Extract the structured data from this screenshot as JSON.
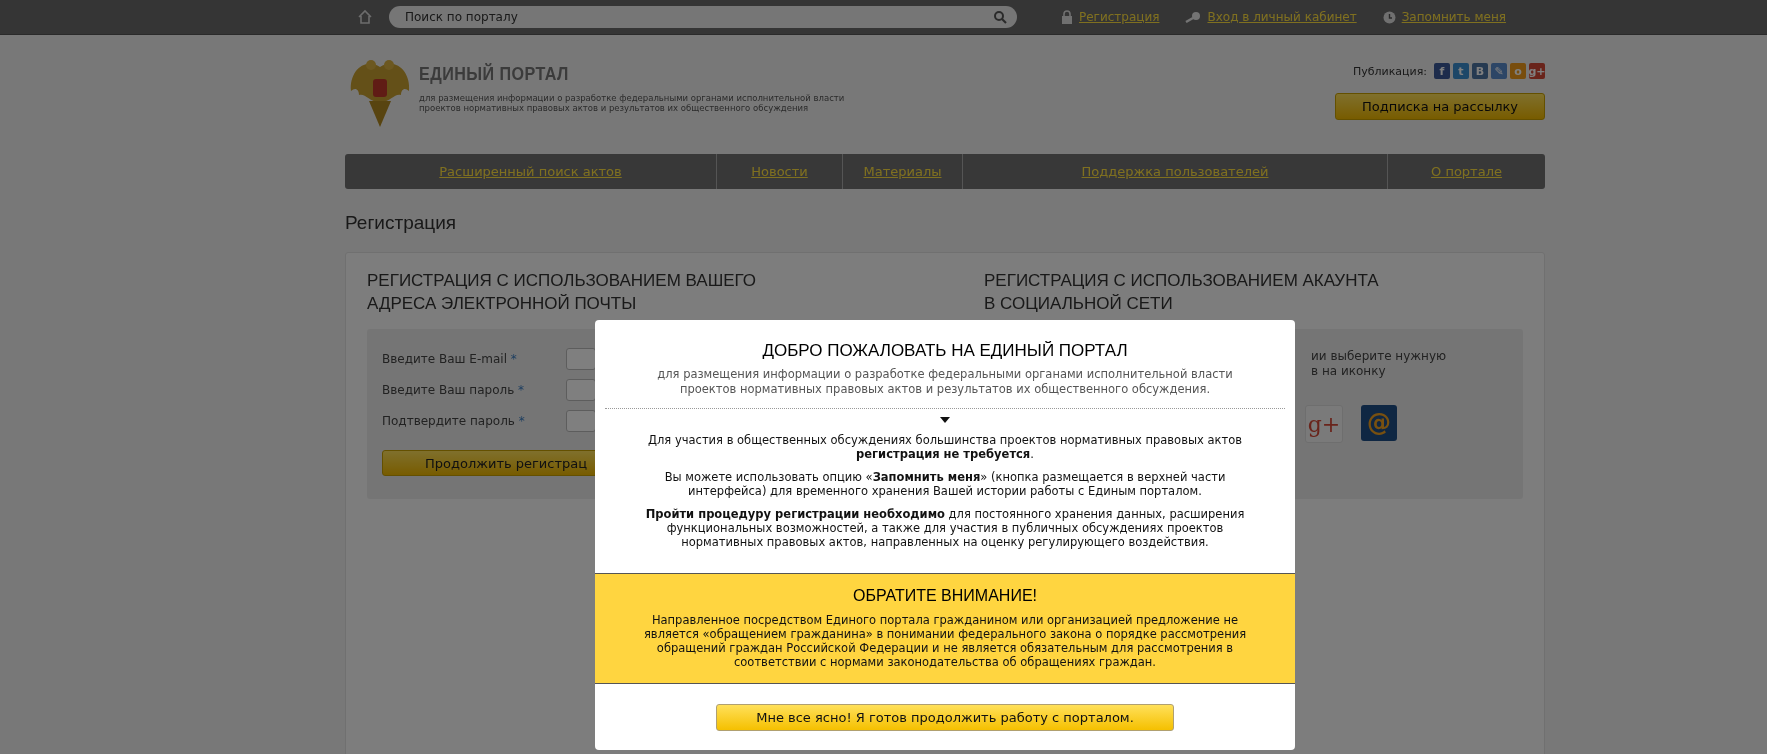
{
  "top_bar": {
    "search": {
      "placeholder": "Поиск по порталу"
    },
    "links": [
      {
        "kind": "lock",
        "label": "Регистрация"
      },
      {
        "kind": "key",
        "label": "Вход в личный кабинет"
      },
      {
        "kind": "clock",
        "label": "Запомнить меня"
      }
    ]
  },
  "header": {
    "title": "ЕДИНЫЙ ПОРТАЛ",
    "subtitle": "для размещения информации о разработке федеральными органами исполнительной власти проектов нормативных правовых актов и результатов их общественного обсуждения",
    "share_label": "Публикация:",
    "share_icons": [
      {
        "kind": "fb",
        "glyph": "f"
      },
      {
        "kind": "tw",
        "glyph": "t"
      },
      {
        "kind": "vk",
        "glyph": "В"
      },
      {
        "kind": "lj",
        "glyph": "✎"
      },
      {
        "kind": "ok",
        "glyph": "о"
      },
      {
        "kind": "gp",
        "glyph": "g+"
      }
    ],
    "subscribe_button": "Подписка на рассылку"
  },
  "nav": [
    {
      "label": "Расширенный поиск актов"
    },
    {
      "label": "Новости"
    },
    {
      "label": "Материалы"
    },
    {
      "label": "Поддержка пользователей"
    },
    {
      "label": "О портале"
    }
  ],
  "page_title": "Регистрация",
  "email_section": {
    "title": "РЕГИСТРАЦИЯ С ИСПОЛЬЗОВАНИЕМ ВАШЕГО АДРЕСА ЭЛЕКТРОННОЙ ПОЧТЫ",
    "fields": [
      {
        "label": "Введите Ваш E-mail",
        "mark": "*"
      },
      {
        "label": "Введите Ваш пароль",
        "mark": "*"
      },
      {
        "label": "Подтвердите пароль",
        "mark": "*"
      }
    ],
    "button": "Продолжить регистрац"
  },
  "social_section": {
    "title": "РЕГИСТРАЦИЯ С ИСПОЛЬЗОВАНИЕМ АКАУНТА В СОЦИАЛЬНОЙ СЕТИ",
    "hint_lines": [
      "ии выберите нужную",
      "в на иконку"
    ],
    "icons": [
      {
        "kind": "gplus",
        "glyph": "g+"
      },
      {
        "kind": "mail",
        "glyph": "@"
      }
    ]
  },
  "modal": {
    "title": "ДОБРО ПОЖАЛОВАТЬ НА ЕДИНЫЙ ПОРТАЛ",
    "subtitle": "для размещения информации о разработке федеральными органами исполнительной власти проектов нормативных правовых актов и результатов их общественного обсуждения.",
    "paragraphs": [
      "Для участия в общественных обсуждениях большинства проектов нормативных правовых актов **регистрация не требуется**.",
      "Вы можете использовать опцию «**Запомнить меня**» (кнопка размещается в верхней части интерфейса) для временного хранения Вашей истории работы с Единым порталом.",
      "**Пройти процедуру регистрации необходимо** для постоянного хранения данных, расширения функциональных возможностей, а также для участия в публичных обсуждениях проектов нормативных правовых актов, направленных на оценку регулирующего воздействия."
    ],
    "notice": {
      "title": "ОБРАТИТЕ ВНИМАНИЕ!",
      "text": "Направленное посредством Единого портала гражданином или организацией предложение не является «обращением гражданина» в понимании федерального закона о порядке рассмотрения обращений граждан Российской Федерации и не является обязательным для рассмотрения в соответствии с нормами законодательства об обращениях граждан."
    },
    "button": "Мне все ясно! Я готов продолжить работу с порталом."
  }
}
